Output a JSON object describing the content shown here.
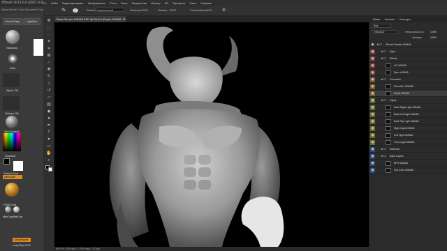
{
  "zbrush": {
    "title": "ZBrush 2021.6.6 [2021.6.6]  ZBr",
    "menu": "Alpha  Brush  Color  Document  Draw",
    "buttons": {
      "home": "Home Page",
      "lightbox": "LightBox"
    },
    "labels": {
      "standard": "Standard",
      "dots": "Dots",
      "alpha": "Alpha Off",
      "texture": "Texture Off",
      "material": "SkinShade4",
      "gradient": "Gradient",
      "switch": "SwitchColor",
      "alternate": "Alternate",
      "pmsoft": "PM3DSoft",
      "matcap1": "MatCap",
      "matcap2": "MatCap",
      "lazymouse": "LazyMouse",
      "lazystep": "LazyStep 0.25"
    }
  },
  "photoshop": {
    "menubar": [
      "Файл",
      "Редактирование",
      "Изображение",
      "Слои",
      "Текст",
      "Выделение",
      "Фильтр",
      "3D",
      "Просмотр",
      "Окно",
      "Справка"
    ],
    "options": {
      "mode_label": "Режим:",
      "mode_value": "Нормальный",
      "opacity_label": "Непрозр.:",
      "opacity_value": "100%",
      "flow_label": "Нажим:",
      "flow_value": "100%",
      "smooth_label": "Сглаживание:",
      "smooth_value": "10%"
    },
    "document_tab": "Base Render #28466.PSD @ 66,6% (Depth #28466, RGB/8) *",
    "status": "66,67%    1280 пикс. x 1000 пикс. (72 ppi)",
    "panel_tabs": [
      "Слои",
      "Каналы",
      "Контуры"
    ],
    "layer_filter": {
      "kind": "Вид",
      "blend": "Обычные",
      "opacity_label": "Непрозрачность:",
      "opacity": "100%",
      "fill_label": "Заливка:",
      "fill": "100%"
    },
    "layers": [
      {
        "name": "ZBrush Render #28466",
        "kind": "group",
        "indent": 0
      },
      {
        "name": "Rgbs",
        "kind": "group",
        "indent": 1
      },
      {
        "name": "Effects",
        "kind": "group",
        "indent": 1
      },
      {
        "name": "AO #28466",
        "kind": "layer",
        "indent": 2
      },
      {
        "name": "Spec #28466",
        "kind": "layer",
        "indent": 2
      },
      {
        "name": "Geometric",
        "kind": "group",
        "indent": 1
      },
      {
        "name": "Normal01 #28466",
        "kind": "layer",
        "indent": 2
      },
      {
        "name": "Depth #28466",
        "kind": "layer",
        "indent": 2
      },
      {
        "name": "Lights",
        "kind": "group",
        "indent": 1
      },
      {
        "name": "Back Right Light #28466",
        "kind": "layer",
        "indent": 2
      },
      {
        "name": "Back Left Light #28466",
        "kind": "layer",
        "indent": 2
      },
      {
        "name": "Back Top Light #28466",
        "kind": "layer",
        "indent": 2
      },
      {
        "name": "Right Light #28466",
        "kind": "layer",
        "indent": 2
      },
      {
        "name": "Left Light #28466",
        "kind": "layer",
        "indent": 2
      },
      {
        "name": "Front Light #28466",
        "kind": "layer",
        "indent": 2
      },
      {
        "name": "Materials",
        "kind": "group",
        "indent": 1
      },
      {
        "name": "Base Layers",
        "kind": "group",
        "indent": 1
      },
      {
        "name": "BPR #28466",
        "kind": "layer",
        "indent": 2
      },
      {
        "name": "Flat Color #28466",
        "kind": "layer",
        "indent": 2
      }
    ],
    "colors": {
      "accent_orange": "#f0a020",
      "selected_layer": "#3d3d3d",
      "red_tag": "#7a3a3a",
      "orange_tag": "#7a5a2a",
      "yellow_tag": "#6a6a2a",
      "blue_tag": "#2a4a7a"
    }
  }
}
